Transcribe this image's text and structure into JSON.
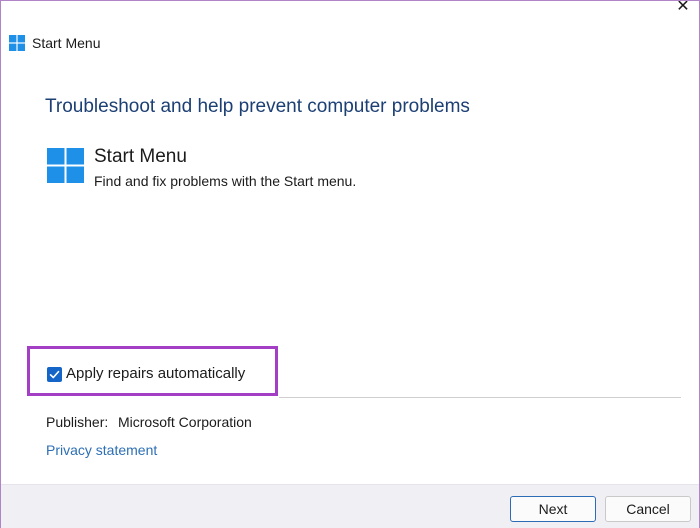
{
  "window": {
    "title": "Start Menu",
    "close_glyph": "✕",
    "icon": "windows-logo-icon"
  },
  "main": {
    "headline": "Troubleshoot and help prevent computer problems",
    "app_title": "Start Menu",
    "app_description": "Find and fix problems with the Start menu.",
    "apply_repairs_label": "Apply repairs automatically",
    "apply_repairs_checked": true
  },
  "publisher": {
    "label": "Publisher:",
    "value": "Microsoft Corporation"
  },
  "links": {
    "privacy": "Privacy statement"
  },
  "footer": {
    "next_label": "Next",
    "cancel_label": "Cancel"
  },
  "colors": {
    "accent": "#1565c8",
    "headline": "#1c3f74",
    "highlight": "#a23fc4",
    "link": "#2d6fb4"
  }
}
